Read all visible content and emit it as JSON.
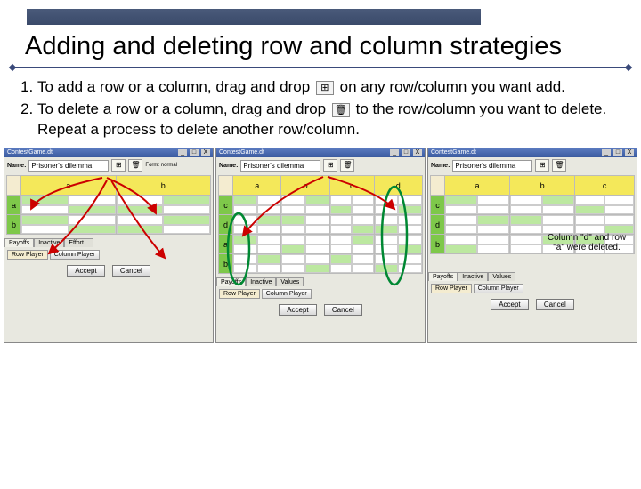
{
  "page": {
    "title": "Adding and deleting row and column strategies"
  },
  "steps": {
    "one_a": "To add a row or a column, drag and drop ",
    "one_b": " on any row/column you want add.",
    "two_a": "To delete a row or a column, drag and drop ",
    "two_b": " to the row/column you want to delete. Repeat a process to delete another row/column."
  },
  "icons": {
    "add": "⊞",
    "trash": "🗑"
  },
  "window": {
    "title": "ContestGame.dt",
    "min": "_",
    "max": "□",
    "close": "X",
    "name_label": "Name:",
    "name_value": "Prisoner's dilemma",
    "form_label": "Form: normal"
  },
  "shot1": {
    "cols": [
      "a",
      "b"
    ],
    "rows": [
      "a",
      "b"
    ]
  },
  "shot2": {
    "cols": [
      "a",
      "b",
      "c",
      "d"
    ],
    "rows": [
      "c",
      "d",
      "a",
      "b"
    ]
  },
  "shot3": {
    "cols": [
      "a",
      "b",
      "c"
    ],
    "rows": [
      "c",
      "d",
      "b"
    ]
  },
  "tabs": {
    "payoffs": "Payoffs",
    "inactive": "Inactive",
    "values": "Values",
    "effort": "Effort..."
  },
  "player_btns": {
    "row": "Row Player",
    "col": "Column Player"
  },
  "dialog": {
    "accept": "Accept",
    "cancel": "Cancel"
  },
  "annotation": "Column \"d\" and row \"a\" were deleted."
}
